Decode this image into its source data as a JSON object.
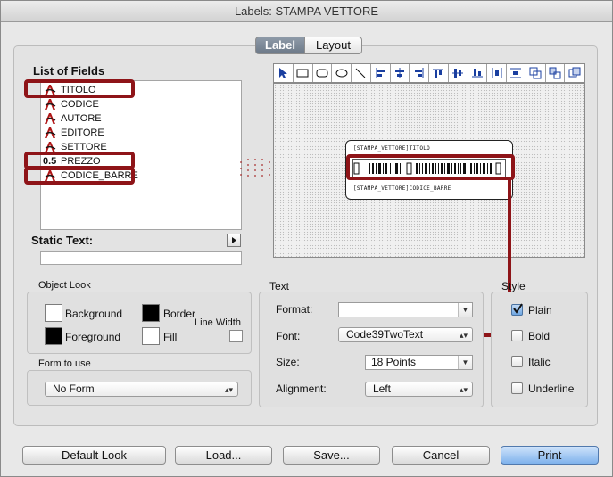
{
  "window": {
    "title": "Labels: STAMPA  VETTORE"
  },
  "tabs": [
    {
      "label": "Label",
      "selected": true
    },
    {
      "label": "Layout",
      "selected": false
    }
  ],
  "fields_panel": {
    "heading": "List of Fields",
    "items": [
      {
        "label": "TITOLO",
        "icon": "text-field-icon"
      },
      {
        "label": "CODICE",
        "icon": "text-field-icon"
      },
      {
        "label": "AUTORE",
        "icon": "text-field-icon"
      },
      {
        "label": "EDITORE",
        "icon": "text-field-icon"
      },
      {
        "label": "SETTORE",
        "icon": "text-field-icon"
      },
      {
        "label": "PREZZO",
        "badge": "0.5",
        "icon": "number-field-icon"
      },
      {
        "label": "CODICE_BARRE",
        "icon": "text-field-icon"
      }
    ],
    "static_text_label": "Static Text:",
    "static_text_value": ""
  },
  "label_preview": {
    "top_text": "[STAMPA_VETTORE]TITOLO",
    "bottom_text": "[STAMPA_VETTORE]CODICE_BARRE"
  },
  "object_look": {
    "title": "Object Look",
    "background_label": "Background",
    "foreground_label": "Foreground",
    "border_label": "Border",
    "fill_label": "Fill",
    "line_width_label": "Line Width",
    "background_color": "#ffffff",
    "foreground_color": "#000000",
    "border_color": "#000000",
    "fill_color": "#ffffff"
  },
  "form_to_use": {
    "title": "Form to use",
    "value": "No Form"
  },
  "text_panel": {
    "title": "Text",
    "format_label": "Format:",
    "format_value": "",
    "font_label": "Font:",
    "font_value": "Code39TwoText",
    "size_label": "Size:",
    "size_value": "18 Points",
    "alignment_label": "Alignment:",
    "alignment_value": "Left"
  },
  "style_panel": {
    "title": "Style",
    "options": [
      {
        "label": "Plain",
        "checked": true
      },
      {
        "label": "Bold",
        "checked": false
      },
      {
        "label": "Italic",
        "checked": false
      },
      {
        "label": "Underline",
        "checked": false
      }
    ]
  },
  "buttons": {
    "default_look": "Default Look",
    "load": "Load...",
    "save": "Save...",
    "cancel": "Cancel",
    "print": "Print"
  },
  "colors": {
    "annotation_red": "#8e1418",
    "accent_blue": "#7fb2ec"
  }
}
